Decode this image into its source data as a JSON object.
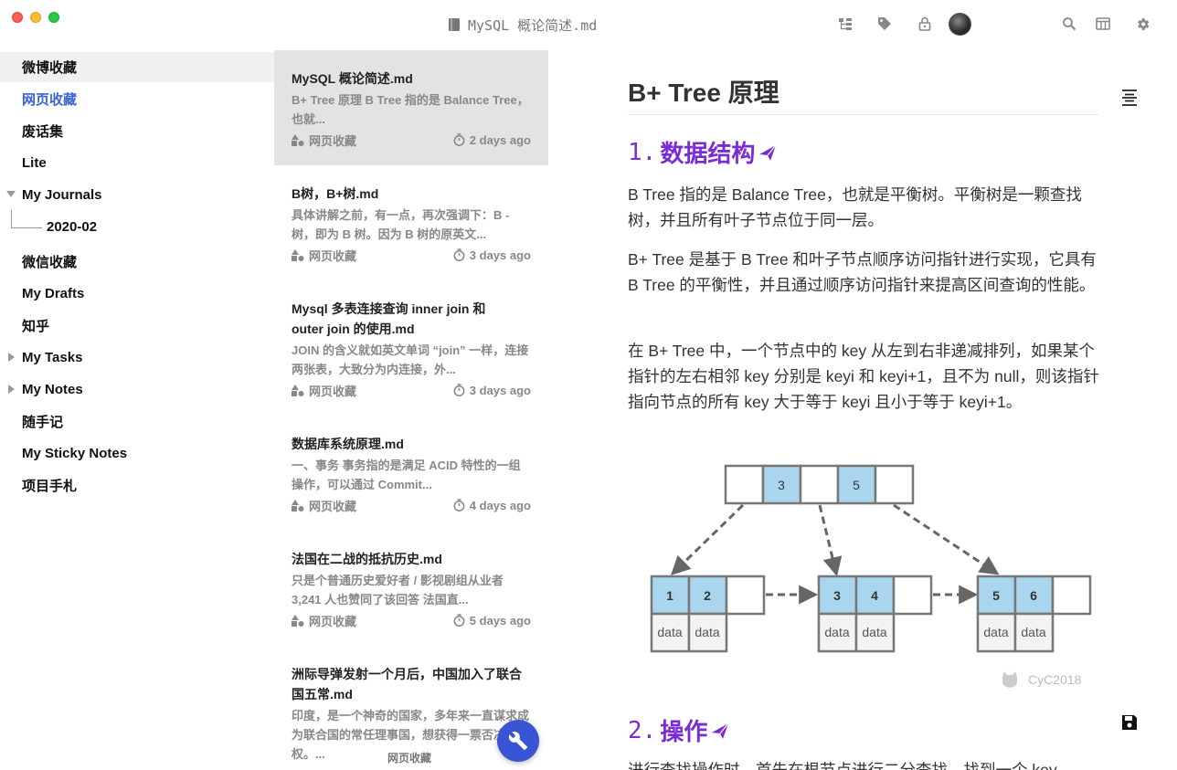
{
  "window": {
    "title": "MySQL 概论简述.md",
    "icons": [
      "document-icon",
      "tree-icon",
      "tag-icon",
      "lock-icon",
      "avatar",
      "search-icon",
      "layout-icon",
      "gear-icon"
    ]
  },
  "sidebar": {
    "items": [
      {
        "label": "微博收藏"
      },
      {
        "label": "网页收藏"
      },
      {
        "label": "废话集"
      },
      {
        "label": "Lite"
      },
      {
        "label": "My Journals"
      },
      {
        "label": "2020-02"
      },
      {
        "label": "微信收藏"
      },
      {
        "label": "My Drafts"
      },
      {
        "label": "知乎"
      },
      {
        "label": "My Tasks"
      },
      {
        "label": "My Notes"
      },
      {
        "label": "随手记"
      },
      {
        "label": "My Sticky Notes"
      },
      {
        "label": "项目手札"
      }
    ]
  },
  "notes": [
    {
      "title": "MySQL 概论简述.md",
      "desc": "B+ Tree 原理 B Tree 指的是 Balance Tree，也就...",
      "folder": "网页收藏",
      "time": "2 days ago"
    },
    {
      "title": "B树，B+树.md",
      "desc": "具体讲解之前，有一点，再次强调下：B - 树，即为 B 树。因为 B 树的原英文...",
      "folder": "网页收藏",
      "time": "3 days ago"
    },
    {
      "title": "Mysql 多表连接查询 inner join 和 outer join 的使用.md",
      "desc": "JOIN 的含义就如英文单词 “join” 一样，连接两张表，大致分为内连接，外...",
      "folder": "网页收藏",
      "time": "3 days ago"
    },
    {
      "title": "数据库系统原理.md",
      "desc": "一、事务 事务指的是满足 ACID 特性的一组操作，可以通过 Commit...",
      "folder": "网页收藏",
      "time": "4 days ago"
    },
    {
      "title": "法国在二战的抵抗历史.md",
      "desc": "只是个普通历史爱好者 / 影视剧组从业者 3,241 人也赞同了该回答 法国直...",
      "folder": "网页收藏",
      "time": "5 days ago"
    },
    {
      "title": "洲际导弹发射一个月后，中国加入了联合国五常.md",
      "desc": "印度，是一个神奇的国家，多年来一直谋求成为联合国的常任理事国，想获得一票否决权。...",
      "folder": "网页收藏",
      "time": ""
    }
  ],
  "fab_tooltip": "网页收藏",
  "editor": {
    "title": "B+ Tree 原理",
    "section1": {
      "num": "1.",
      "label": "数据结构"
    },
    "p1": "B Tree 指的是 Balance Tree，也就是平衡树。平衡树是一颗查找树，并且所有叶子节点位于同一层。",
    "p2": "B+ Tree 是基于 B Tree 和叶子节点顺序访问指针进行实现，它具有 B Tree 的平衡性，并且通过顺序访问指针来提高区间查询的性能。",
    "p3": "在 B+ Tree 中，一个节点中的 key 从左到右非递减排列，如果某个指针的左右相邻 key 分别是 keyi 和 keyi+1，且不为 null，则该指针指向节点的所有 key 大于等于 keyi 且小于等于 keyi+1。",
    "section2": {
      "num": "2.",
      "label": "操作"
    },
    "p4": "进行查找操作时，首先在根节点进行二分查找，找到一个 key",
    "diagram": {
      "root_keys": [
        "3",
        "5"
      ],
      "leaves": [
        [
          "1",
          "2"
        ],
        [
          "3",
          "4"
        ],
        [
          "5",
          "6"
        ]
      ],
      "data_label": "data",
      "watermark": "CyC2018"
    }
  },
  "colors": {
    "accent": "#3a55d4",
    "heading": "#7a2bd8",
    "active_link": "#3a63d8",
    "key_fill": "#a9d6ee"
  }
}
